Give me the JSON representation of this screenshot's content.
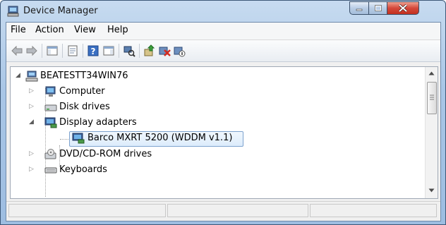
{
  "window": {
    "title": "Device Manager"
  },
  "menu": {
    "items": [
      {
        "label": "File"
      },
      {
        "label": "Action"
      },
      {
        "label": "View"
      },
      {
        "label": "Help"
      }
    ]
  },
  "toolbar": {
    "buttons": [
      "back-arrow-icon",
      "forward-arrow-icon",
      "show-hide-console-tree-icon",
      "properties-icon",
      "help-icon",
      "action-pane-icon",
      "scan-hardware-icon",
      "update-driver-icon",
      "uninstall-icon",
      "disable-device-icon"
    ]
  },
  "tree": {
    "root": {
      "label": "BEATESTT34WIN76",
      "expanded": true
    },
    "items": [
      {
        "label": "Computer",
        "expanded": false,
        "icon": "computer-icon"
      },
      {
        "label": "Disk drives",
        "expanded": false,
        "icon": "disk-drive-icon"
      },
      {
        "label": "Display adapters",
        "expanded": true,
        "icon": "display-adapter-icon"
      },
      {
        "label": "Barco MXRT 5200 (WDDM v1.1)",
        "child": true,
        "selected": true,
        "icon": "display-adapter-icon"
      },
      {
        "label": "DVD/CD-ROM drives",
        "expanded": false,
        "icon": "dvd-drive-icon"
      },
      {
        "label": "Keyboards",
        "expanded": false,
        "icon": "keyboard-icon"
      }
    ]
  },
  "colors": {
    "title_bar": "#a9c6e6",
    "close_button": "#d4483a",
    "selection": "#dcecfc"
  }
}
